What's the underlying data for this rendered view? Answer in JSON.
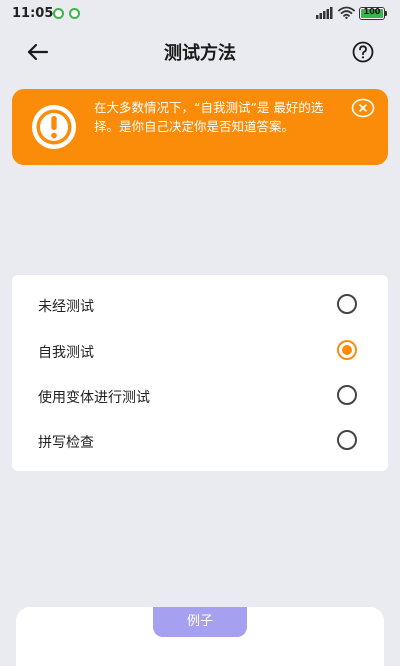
{
  "status_bar": {
    "time": "11:05",
    "battery": "100",
    "icons": [
      "notification-dot-icon",
      "notification-dot-icon",
      "signal-icon",
      "wifi-icon",
      "battery-icon"
    ]
  },
  "header": {
    "title": "测试方法",
    "back_icon": "arrow-left-icon",
    "help_icon": "question-circle-icon"
  },
  "banner": {
    "text": "在大多数情况下，“自我测试”是 最好的选择。是你自己决定你是否知道答案。",
    "icon": "exclamation-circle-icon",
    "close_icon": "close-circle-icon",
    "color": "#fb8c09"
  },
  "options": [
    {
      "label": "未经测试",
      "selected": false
    },
    {
      "label": "自我测试",
      "selected": true
    },
    {
      "label": "使用变体进行测试",
      "selected": false
    },
    {
      "label": "拼写检查",
      "selected": false
    }
  ],
  "example": {
    "tab_label": "例子",
    "tab_color": "#a5a0f0"
  },
  "colors": {
    "accent": "#fb8c09",
    "background": "#e9ebf0"
  }
}
